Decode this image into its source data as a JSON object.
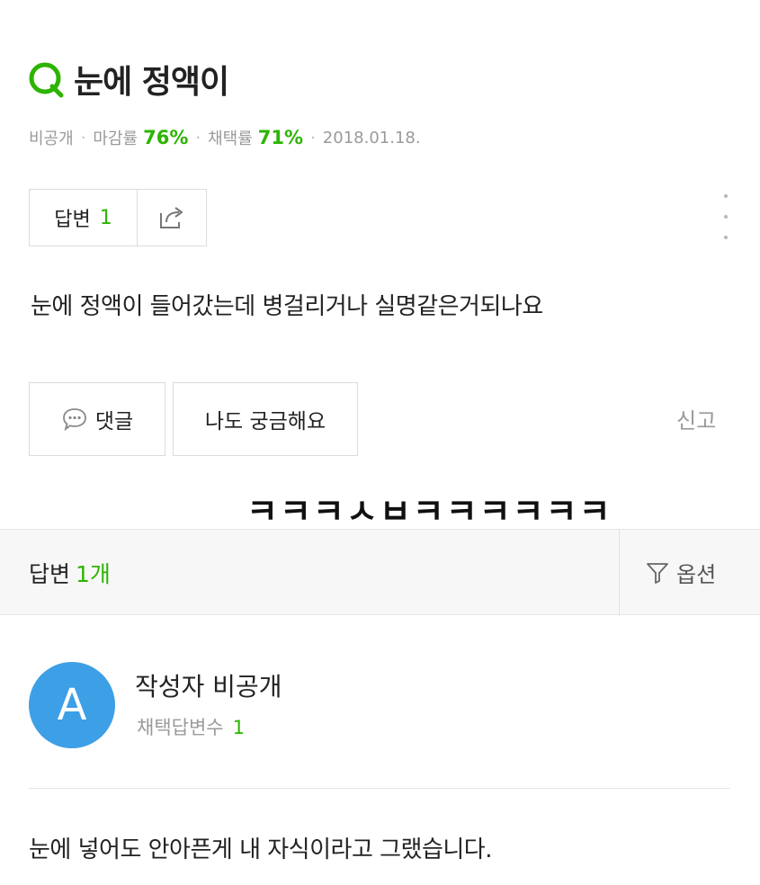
{
  "question": {
    "title": "눈에 정액이",
    "meta": {
      "visibility": "비공개",
      "deadline_label": "마감률",
      "deadline_rate": "76%",
      "adopt_label": "채택률",
      "adopt_rate": "71%",
      "date": "2018.01.18."
    },
    "answer_label": "답변",
    "answer_count": "1",
    "body": "눈에 정액이 들어갔는데 병걸리거나 실명같은거되나요"
  },
  "actions": {
    "comment_label": "댓글",
    "curious_label": "나도 궁금해요",
    "report_label": "신고"
  },
  "overlay_text": "ㅋㅋㅋㅅㅂㅋㅋㅋㅋㅋㅋ",
  "answers_bar": {
    "label": "답변",
    "count": "1개",
    "option_label": "옵션"
  },
  "answer": {
    "avatar_letter": "A",
    "author": "작성자 비공개",
    "stat_label": "채택답변수",
    "stat_value": "1",
    "body": "눈에 넣어도 안아픈게 내 자식이라고 그랬습니다."
  },
  "colors": {
    "accent_green": "#2db400",
    "avatar_blue": "#3d9fe6"
  },
  "icons": [
    "q-icon",
    "share-icon",
    "more-icon",
    "comment-bubble-icon",
    "filter-icon"
  ]
}
